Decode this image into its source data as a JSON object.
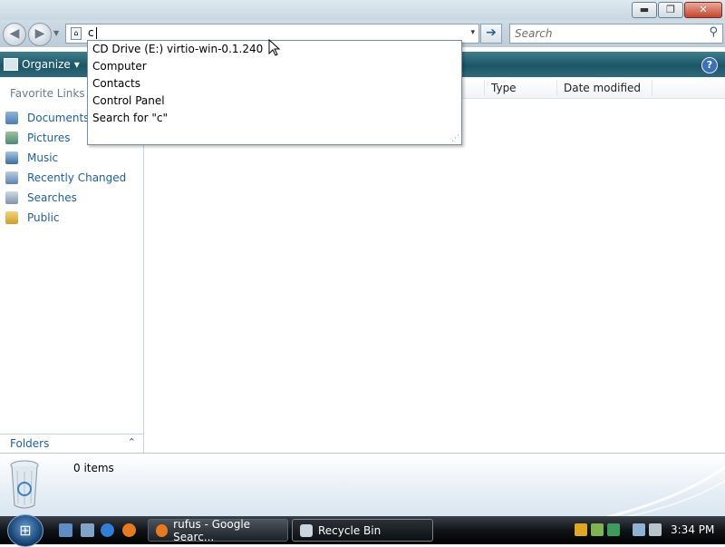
{
  "window": {
    "buttons": {
      "minimize": "▬",
      "maximize": "❐",
      "close": "✕"
    }
  },
  "address": {
    "value": "c",
    "dropdown_arrow": "▾",
    "go_symbol": "➔"
  },
  "search": {
    "placeholder": "Search",
    "icon": "magnifier-icon"
  },
  "toolbar": {
    "organize_label": "Organize",
    "organize_caret": "▾",
    "help": "?"
  },
  "autocomplete": {
    "items": [
      "CD Drive (E:) virtio-win-0.1.240",
      "Computer",
      "Contacts",
      "Control Panel",
      "Search for \"c\""
    ]
  },
  "sidebar": {
    "title": "Favorite Links",
    "items": [
      {
        "label": "Documents",
        "icon": "documents-icon"
      },
      {
        "label": "Pictures",
        "icon": "pictures-icon"
      },
      {
        "label": "Music",
        "icon": "music-icon"
      },
      {
        "label": "Recently Changed",
        "icon": "recently-changed-icon"
      },
      {
        "label": "Searches",
        "icon": "searches-icon"
      },
      {
        "label": "Public",
        "icon": "public-folder-icon"
      }
    ],
    "folders_label": "Folders",
    "folders_chevron": "⌃"
  },
  "columns": [
    "Type",
    "Date modified"
  ],
  "details": {
    "item_count": "0 items",
    "icon": "recycle-bin-icon"
  },
  "taskbar": {
    "start_icon": "windows-start-orb-icon",
    "buttons": [
      {
        "label": "rufus - Google Searc...",
        "icon": "firefox-icon"
      },
      {
        "label": "Recycle Bin",
        "icon": "recycle-bin-icon"
      }
    ],
    "clock": "3:34 PM"
  },
  "colors": {
    "link": "#1c5fa8",
    "commandbar": "#1d5565",
    "taskbar": "#101418"
  }
}
